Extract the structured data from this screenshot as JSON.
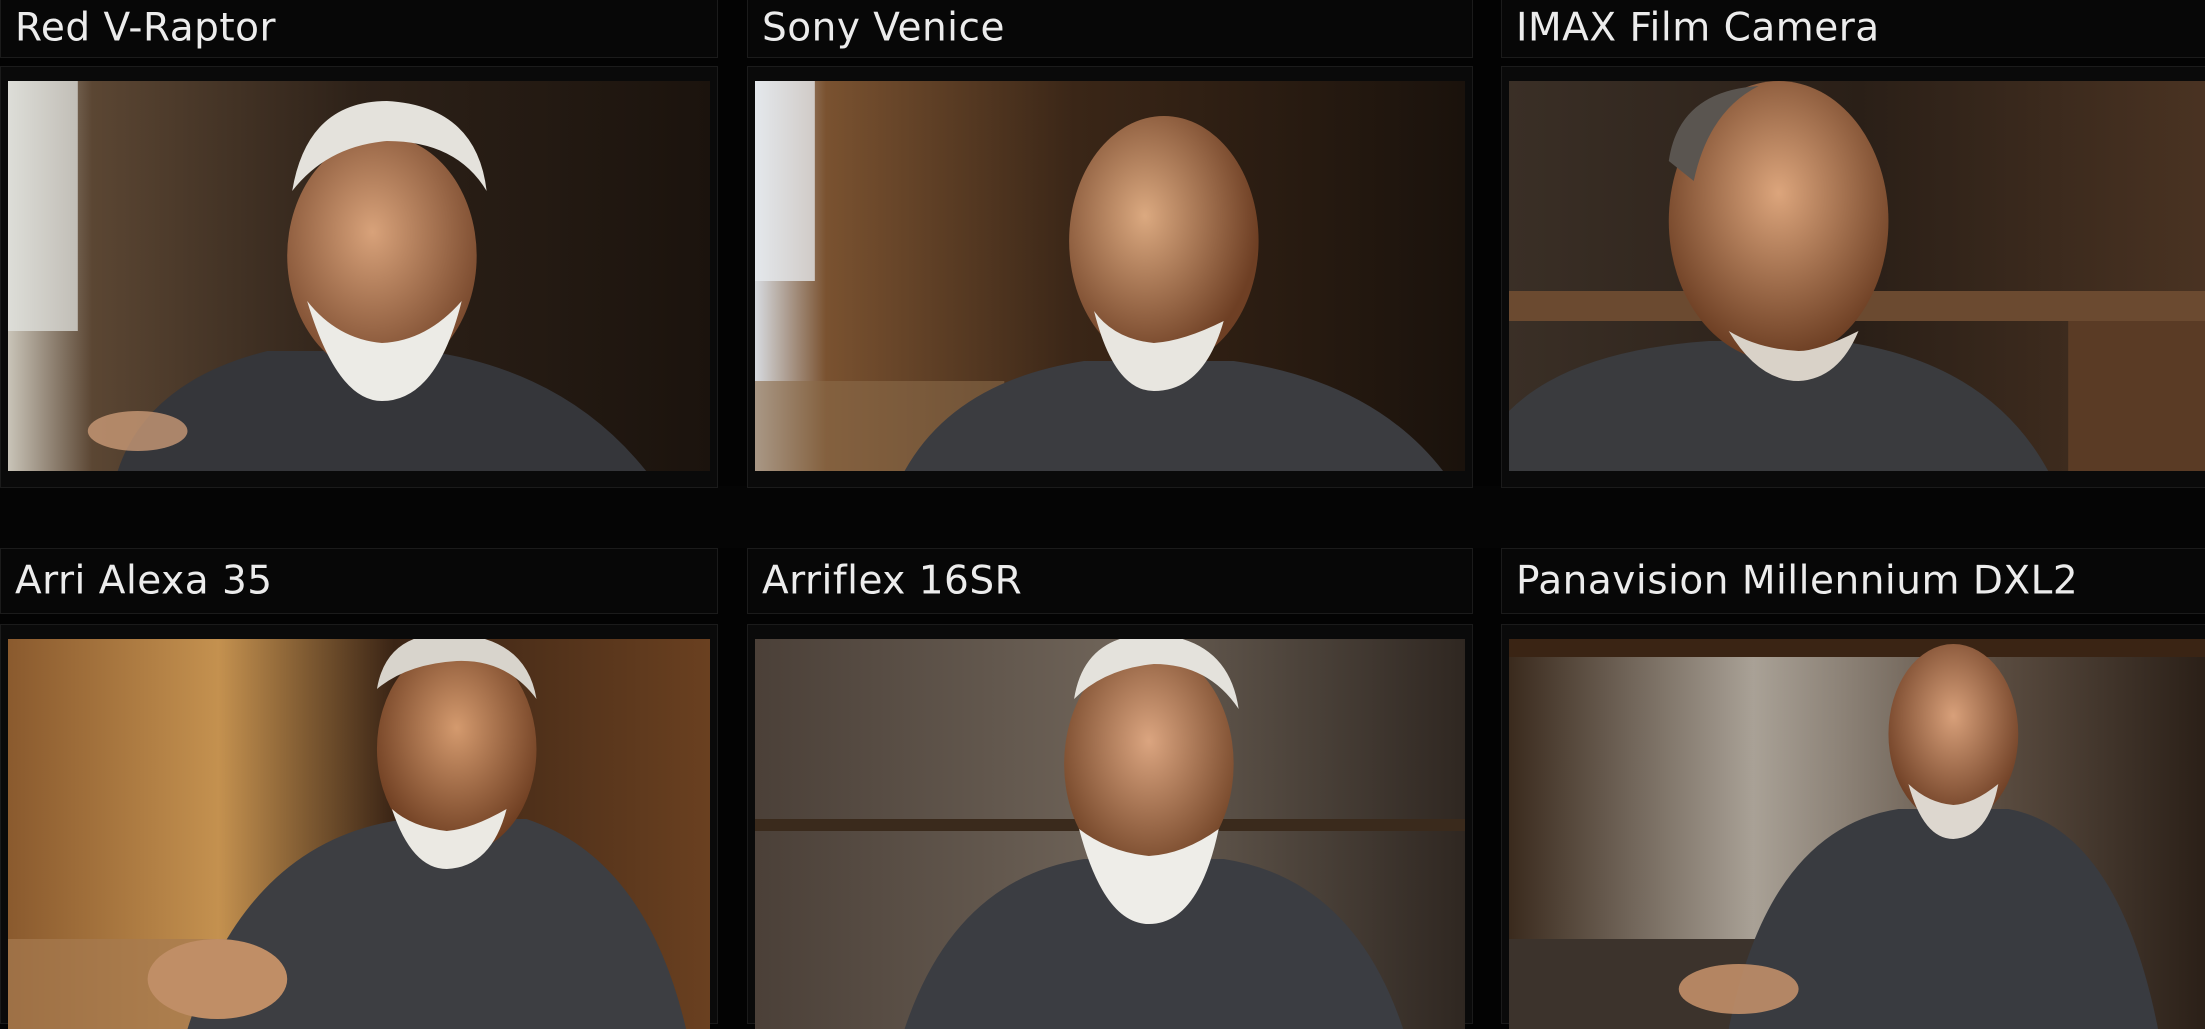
{
  "cards": [
    {
      "label": "Red V-Raptor",
      "image": "portrait of elderly man with white beard in workshop"
    },
    {
      "label": "Sony Venice",
      "image": "portrait of elderly man with white beard in workshop"
    },
    {
      "label": "IMAX Film Camera",
      "image": "portrait of elderly man in workshop"
    },
    {
      "label": "Arri Alexa 35",
      "image": "portrait of elderly man with white beard in workshop"
    },
    {
      "label": "Arriflex 16SR",
      "image": "portrait of elderly man with white beard in workshop"
    },
    {
      "label": "Panavision Millennium DXL2",
      "image": "portrait of elderly man in workshop"
    }
  ]
}
